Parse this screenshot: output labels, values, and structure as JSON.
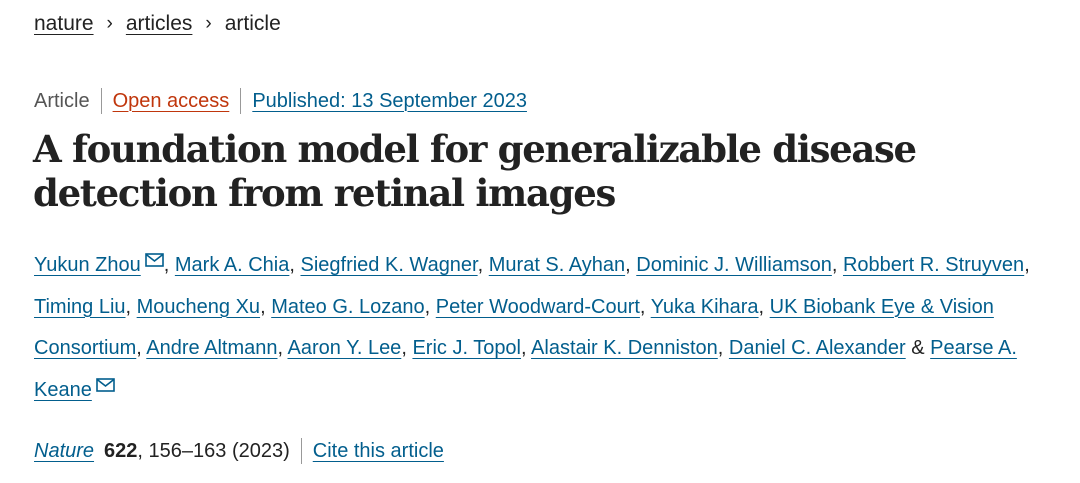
{
  "breadcrumb": {
    "items": [
      {
        "label": "nature"
      },
      {
        "label": "articles"
      }
    ],
    "separator": "›",
    "current": "article"
  },
  "meta": {
    "type": "Article",
    "access": "Open access",
    "published": "Published: 13 September 2023"
  },
  "title": "A foundation model for generalizable disease detection from retinal images",
  "authors": [
    {
      "name": "Yukun Zhou",
      "email_icon": "mail-icon",
      "sep": ", "
    },
    {
      "name": "Mark A. Chia",
      "sep": ", "
    },
    {
      "name": "Siegfried K. Wagner",
      "sep": ", "
    },
    {
      "name": "Murat S. Ayhan",
      "sep": ", "
    },
    {
      "name": "Dominic J. Williamson",
      "sep": ", "
    },
    {
      "name": "Robbert R. Struyven",
      "sep": ", "
    },
    {
      "name": "Timing Liu",
      "sep": ", "
    },
    {
      "name": "Moucheng Xu",
      "sep": ", "
    },
    {
      "name": "Mateo G. Lozano",
      "sep": ", "
    },
    {
      "name": "Peter Woodward-Court",
      "sep": ", "
    },
    {
      "name": "Yuka Kihara",
      "sep": ", "
    },
    {
      "name": "UK Biobank Eye & Vision Consortium",
      "sep": ", "
    },
    {
      "name": "Andre Altmann",
      "sep": ", "
    },
    {
      "name": "Aaron Y. Lee",
      "sep": ", "
    },
    {
      "name": "Eric J. Topol",
      "sep": ", "
    },
    {
      "name": "Alastair K. Denniston",
      "sep": ", "
    },
    {
      "name": "Daniel C. Alexander",
      "sep": " & "
    },
    {
      "name": "Pearse A. Keane",
      "email_icon": "mail-icon",
      "sep": ""
    }
  ],
  "citation": {
    "journal": "Nature",
    "volume": "622",
    "pages": ", 156–163 (2023)",
    "cite_link": "Cite this article"
  },
  "colors": {
    "link": "#025e8d",
    "open_access": "#c0360c",
    "text": "#222222"
  }
}
